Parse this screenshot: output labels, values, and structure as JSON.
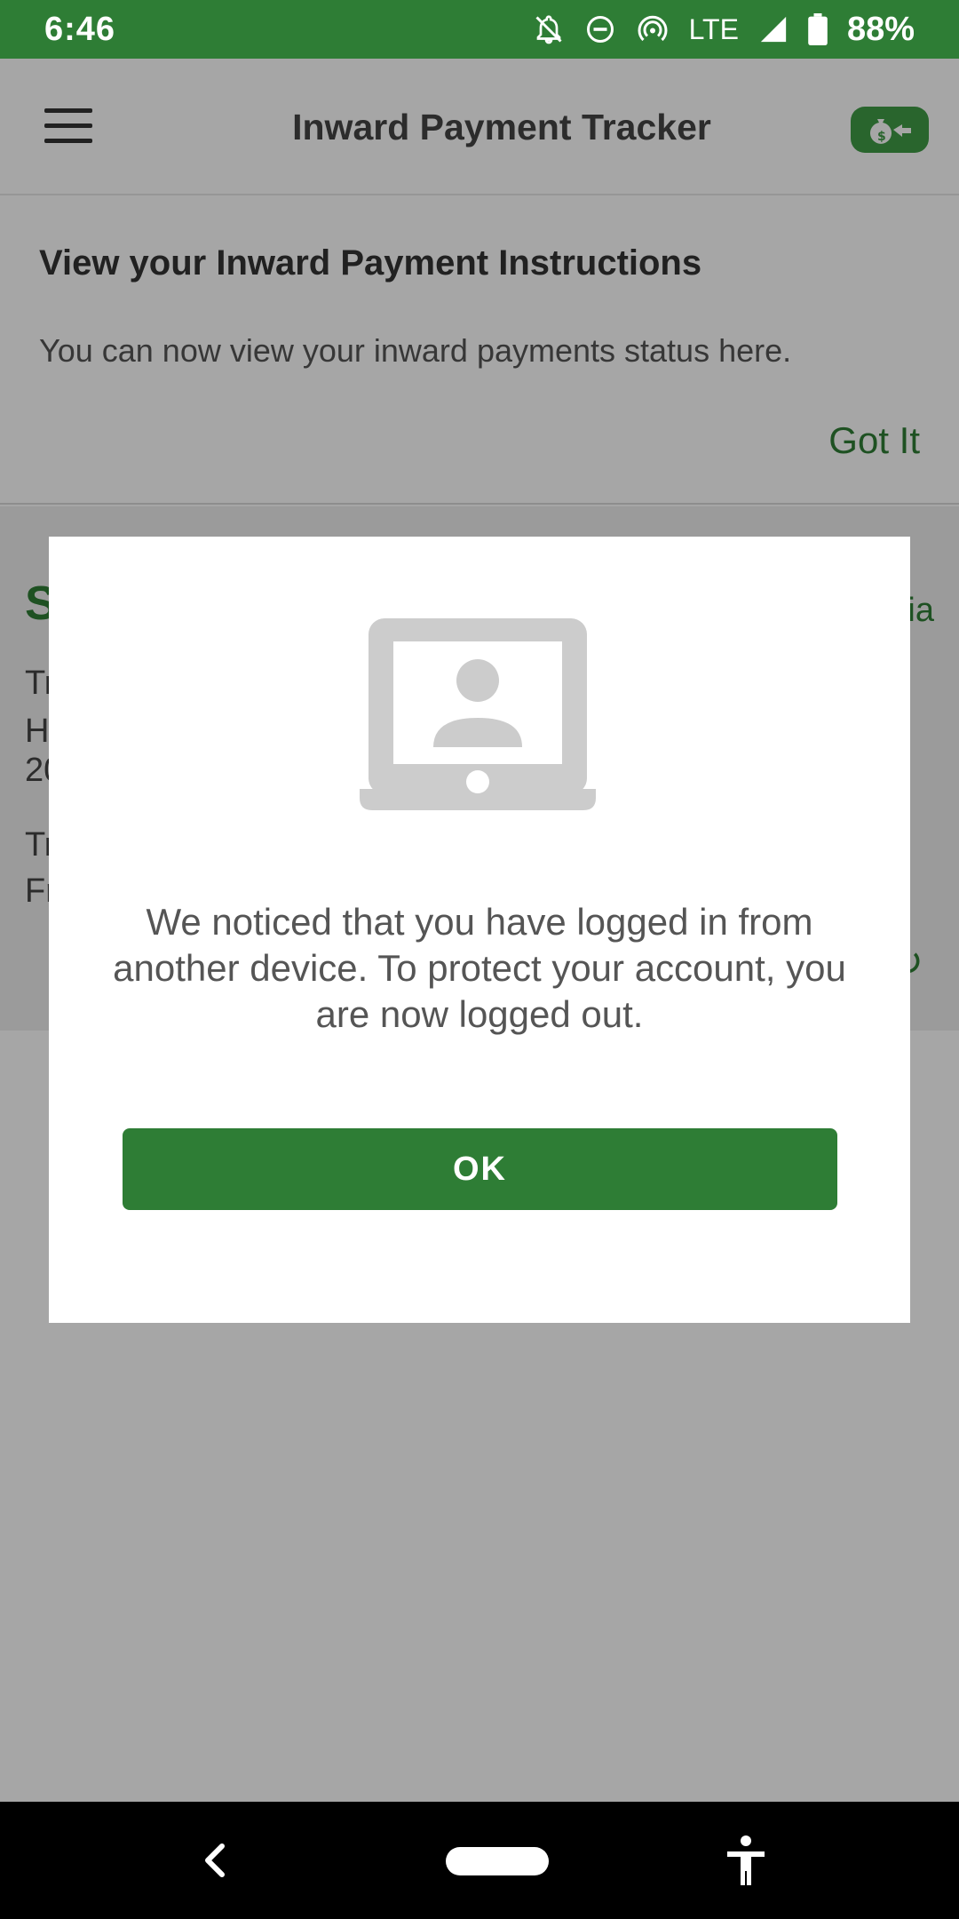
{
  "status_bar": {
    "time": "6:46",
    "network": "LTE",
    "battery": "88%",
    "icons": [
      "notifications-off-icon",
      "do-not-disturb-icon",
      "hotspot-icon",
      "signal-icon",
      "battery-icon"
    ]
  },
  "app_bar": {
    "title": "Inward Payment Tracker",
    "menu_icon": "menu-icon",
    "badge_icon": "money-transfer-icon"
  },
  "info_card": {
    "title": "View your Inward Payment Instructions",
    "text": "You can now view your inward payments status here.",
    "action": "Got It"
  },
  "background": {
    "heading_fragment": "S",
    "line1": "Tr",
    "line2": "H",
    "line3": "20",
    "line4": "Tr",
    "line5": "Fr",
    "right_fragment": "ia"
  },
  "dialog": {
    "icon": "laptop-user-icon",
    "message": "We noticed that you have logged in from another device. To protect your account, you are now logged out.",
    "ok_label": "OK"
  },
  "nav_bar": {
    "icons": [
      "back-icon",
      "home-icon",
      "accessibility-icon"
    ]
  },
  "colors": {
    "primary": "#2e7d35",
    "scrim": "rgba(0,0,0,0.35)"
  }
}
